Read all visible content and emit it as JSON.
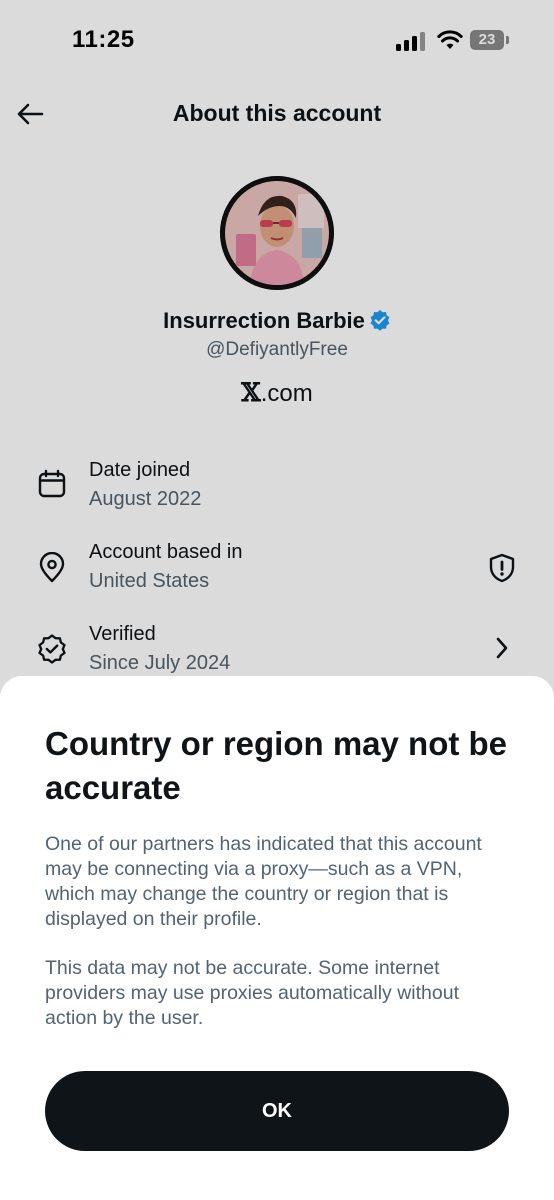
{
  "status_bar": {
    "time": "11:25",
    "battery": "23"
  },
  "header": {
    "title": "About this account"
  },
  "profile": {
    "name": "Insurrection Barbie",
    "handle": "@DefiyantlyFree",
    "site_mark": "𝕏",
    "site_suffix": ".com"
  },
  "info_rows": [
    {
      "label": "Date joined",
      "value": "August 2022",
      "icon": "calendar-icon"
    },
    {
      "label": "Account based in",
      "value": "United States",
      "icon": "location-pin-icon",
      "action_icon": "shield-alert-icon"
    },
    {
      "label": "Verified",
      "value": "Since July 2024",
      "icon": "verified-seal-icon",
      "action_icon": "chevron-right-icon"
    }
  ],
  "sheet": {
    "title": "Country or region may not be accurate",
    "paragraph1": "One of our partners has indicated that this account may be connecting via a proxy—such as a VPN, which may change the country or region that is displayed on their profile.",
    "paragraph2": "This data may not be accurate. Some internet providers may use proxies automatically without action by the user.",
    "ok_label": "OK"
  },
  "colors": {
    "text_primary": "#0f1419",
    "text_secondary": "#536471",
    "verified_blue": "#1d9bf0",
    "button_bg": "#0f1419"
  }
}
